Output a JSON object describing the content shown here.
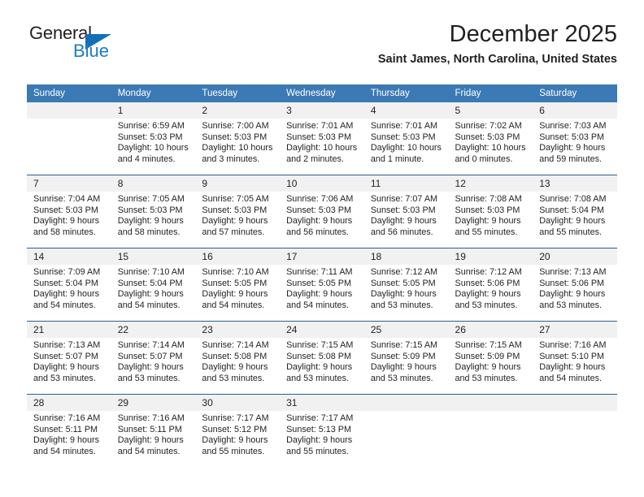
{
  "brand": {
    "name_part1": "General",
    "name_part2": "Blue",
    "triangle_color": "#1270b8",
    "blue_color": "#1b7bc4"
  },
  "header": {
    "title": "December 2025",
    "subtitle": "Saint James, North Carolina, United States"
  },
  "theme": {
    "header_blue": "#3b7ab4",
    "separator_blue": "#2a5f8f",
    "daynum_band": "#f1f1f1",
    "text": "#231f20"
  },
  "calendar": {
    "weekday_headers": [
      "Sunday",
      "Monday",
      "Tuesday",
      "Wednesday",
      "Thursday",
      "Friday",
      "Saturday"
    ],
    "weeks": [
      [
        {
          "day": "",
          "empty": true
        },
        {
          "day": "1",
          "sunrise": "Sunrise: 6:59 AM",
          "sunset": "Sunset: 5:03 PM",
          "daylight": "Daylight: 10 hours and 4 minutes."
        },
        {
          "day": "2",
          "sunrise": "Sunrise: 7:00 AM",
          "sunset": "Sunset: 5:03 PM",
          "daylight": "Daylight: 10 hours and 3 minutes."
        },
        {
          "day": "3",
          "sunrise": "Sunrise: 7:01 AM",
          "sunset": "Sunset: 5:03 PM",
          "daylight": "Daylight: 10 hours and 2 minutes."
        },
        {
          "day": "4",
          "sunrise": "Sunrise: 7:01 AM",
          "sunset": "Sunset: 5:03 PM",
          "daylight": "Daylight: 10 hours and 1 minute."
        },
        {
          "day": "5",
          "sunrise": "Sunrise: 7:02 AM",
          "sunset": "Sunset: 5:03 PM",
          "daylight": "Daylight: 10 hours and 0 minutes."
        },
        {
          "day": "6",
          "sunrise": "Sunrise: 7:03 AM",
          "sunset": "Sunset: 5:03 PM",
          "daylight": "Daylight: 9 hours and 59 minutes."
        }
      ],
      [
        {
          "day": "7",
          "sunrise": "Sunrise: 7:04 AM",
          "sunset": "Sunset: 5:03 PM",
          "daylight": "Daylight: 9 hours and 58 minutes."
        },
        {
          "day": "8",
          "sunrise": "Sunrise: 7:05 AM",
          "sunset": "Sunset: 5:03 PM",
          "daylight": "Daylight: 9 hours and 58 minutes."
        },
        {
          "day": "9",
          "sunrise": "Sunrise: 7:05 AM",
          "sunset": "Sunset: 5:03 PM",
          "daylight": "Daylight: 9 hours and 57 minutes."
        },
        {
          "day": "10",
          "sunrise": "Sunrise: 7:06 AM",
          "sunset": "Sunset: 5:03 PM",
          "daylight": "Daylight: 9 hours and 56 minutes."
        },
        {
          "day": "11",
          "sunrise": "Sunrise: 7:07 AM",
          "sunset": "Sunset: 5:03 PM",
          "daylight": "Daylight: 9 hours and 56 minutes."
        },
        {
          "day": "12",
          "sunrise": "Sunrise: 7:08 AM",
          "sunset": "Sunset: 5:03 PM",
          "daylight": "Daylight: 9 hours and 55 minutes."
        },
        {
          "day": "13",
          "sunrise": "Sunrise: 7:08 AM",
          "sunset": "Sunset: 5:04 PM",
          "daylight": "Daylight: 9 hours and 55 minutes."
        }
      ],
      [
        {
          "day": "14",
          "sunrise": "Sunrise: 7:09 AM",
          "sunset": "Sunset: 5:04 PM",
          "daylight": "Daylight: 9 hours and 54 minutes."
        },
        {
          "day": "15",
          "sunrise": "Sunrise: 7:10 AM",
          "sunset": "Sunset: 5:04 PM",
          "daylight": "Daylight: 9 hours and 54 minutes."
        },
        {
          "day": "16",
          "sunrise": "Sunrise: 7:10 AM",
          "sunset": "Sunset: 5:05 PM",
          "daylight": "Daylight: 9 hours and 54 minutes."
        },
        {
          "day": "17",
          "sunrise": "Sunrise: 7:11 AM",
          "sunset": "Sunset: 5:05 PM",
          "daylight": "Daylight: 9 hours and 54 minutes."
        },
        {
          "day": "18",
          "sunrise": "Sunrise: 7:12 AM",
          "sunset": "Sunset: 5:05 PM",
          "daylight": "Daylight: 9 hours and 53 minutes."
        },
        {
          "day": "19",
          "sunrise": "Sunrise: 7:12 AM",
          "sunset": "Sunset: 5:06 PM",
          "daylight": "Daylight: 9 hours and 53 minutes."
        },
        {
          "day": "20",
          "sunrise": "Sunrise: 7:13 AM",
          "sunset": "Sunset: 5:06 PM",
          "daylight": "Daylight: 9 hours and 53 minutes."
        }
      ],
      [
        {
          "day": "21",
          "sunrise": "Sunrise: 7:13 AM",
          "sunset": "Sunset: 5:07 PM",
          "daylight": "Daylight: 9 hours and 53 minutes."
        },
        {
          "day": "22",
          "sunrise": "Sunrise: 7:14 AM",
          "sunset": "Sunset: 5:07 PM",
          "daylight": "Daylight: 9 hours and 53 minutes."
        },
        {
          "day": "23",
          "sunrise": "Sunrise: 7:14 AM",
          "sunset": "Sunset: 5:08 PM",
          "daylight": "Daylight: 9 hours and 53 minutes."
        },
        {
          "day": "24",
          "sunrise": "Sunrise: 7:15 AM",
          "sunset": "Sunset: 5:08 PM",
          "daylight": "Daylight: 9 hours and 53 minutes."
        },
        {
          "day": "25",
          "sunrise": "Sunrise: 7:15 AM",
          "sunset": "Sunset: 5:09 PM",
          "daylight": "Daylight: 9 hours and 53 minutes."
        },
        {
          "day": "26",
          "sunrise": "Sunrise: 7:15 AM",
          "sunset": "Sunset: 5:09 PM",
          "daylight": "Daylight: 9 hours and 53 minutes."
        },
        {
          "day": "27",
          "sunrise": "Sunrise: 7:16 AM",
          "sunset": "Sunset: 5:10 PM",
          "daylight": "Daylight: 9 hours and 54 minutes."
        }
      ],
      [
        {
          "day": "28",
          "sunrise": "Sunrise: 7:16 AM",
          "sunset": "Sunset: 5:11 PM",
          "daylight": "Daylight: 9 hours and 54 minutes."
        },
        {
          "day": "29",
          "sunrise": "Sunrise: 7:16 AM",
          "sunset": "Sunset: 5:11 PM",
          "daylight": "Daylight: 9 hours and 54 minutes."
        },
        {
          "day": "30",
          "sunrise": "Sunrise: 7:17 AM",
          "sunset": "Sunset: 5:12 PM",
          "daylight": "Daylight: 9 hours and 55 minutes."
        },
        {
          "day": "31",
          "sunrise": "Sunrise: 7:17 AM",
          "sunset": "Sunset: 5:13 PM",
          "daylight": "Daylight: 9 hours and 55 minutes."
        },
        {
          "day": "",
          "empty": true
        },
        {
          "day": "",
          "empty": true
        },
        {
          "day": "",
          "empty": true
        }
      ]
    ]
  }
}
